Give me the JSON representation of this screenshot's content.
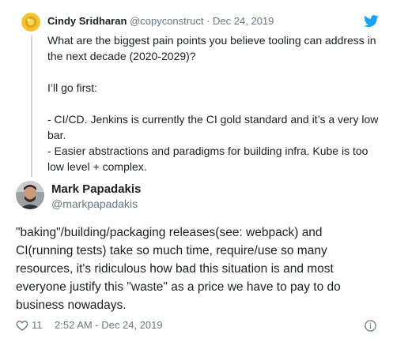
{
  "quoted_tweet": {
    "author_name": "Cindy Sridharan",
    "handle": "@copyconstruct",
    "separator": "·",
    "date": "Dec 24, 2019",
    "text_lines": [
      "What are the biggest pain points you believe tooling can address in the next decade (2020-2029)?",
      "",
      "I’ll go first:",
      "",
      "- CI/CD. Jenkins is currently the CI gold standard and it’s a very low bar.",
      "- Easier abstractions and paradigms for building infra. Kube is too low level + complex."
    ]
  },
  "main_tweet": {
    "author_name": "Mark Papadakis",
    "handle": "@markpapadakis",
    "text": "\"baking\"/building/packaging releases(see: webpack) and CI(running tests) take so much time, require/use so many resources, it's ridiculous how bad this situation is and most everyone justify this \"waste\" as a price we have to pay to do business nowadays.",
    "like_count": "11",
    "timestamp": "2:52 AM - Dec 24, 2019"
  },
  "icons": {
    "brand": "twitter-bird-icon",
    "like": "heart-icon",
    "info": "info-icon"
  },
  "colors": {
    "twitter_blue": "#1da1f2",
    "text_primary": "#1c2022",
    "text_secondary": "#697882",
    "thread_line": "#cfd9de"
  }
}
